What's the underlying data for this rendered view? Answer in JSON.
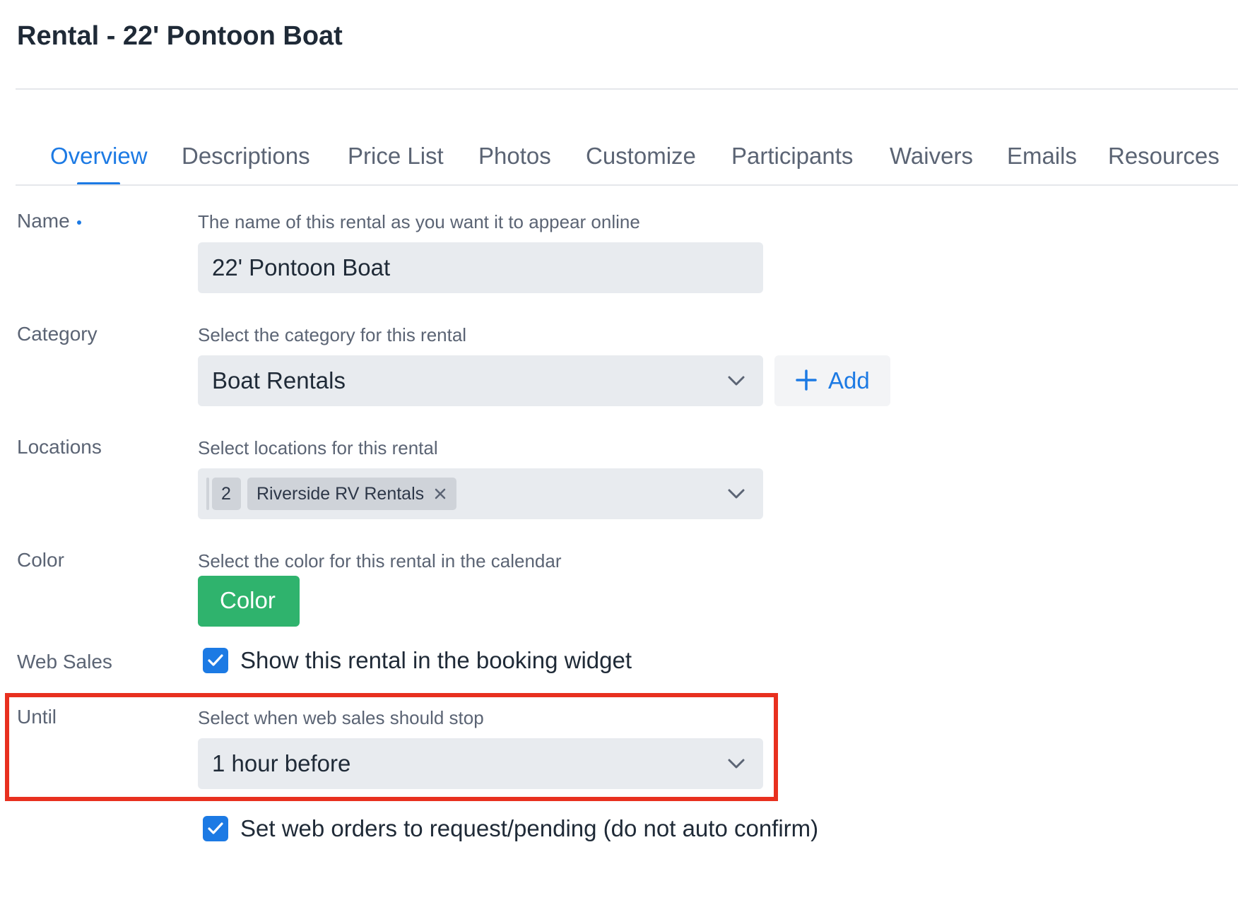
{
  "page": {
    "title": "Rental - 22' Pontoon Boat"
  },
  "tabs": [
    {
      "label": "Overview",
      "active": true
    },
    {
      "label": "Descriptions"
    },
    {
      "label": "Price List"
    },
    {
      "label": "Photos"
    },
    {
      "label": "Customize"
    },
    {
      "label": "Participants"
    },
    {
      "label": "Waivers"
    },
    {
      "label": "Emails"
    },
    {
      "label": "Resources"
    }
  ],
  "form": {
    "name": {
      "label": "Name",
      "required": true,
      "help": "The name of this rental as you want it to appear online",
      "value": "22' Pontoon Boat"
    },
    "category": {
      "label": "Category",
      "help": "Select the category for this rental",
      "value": "Boat Rentals",
      "add_label": "Add"
    },
    "locations": {
      "label": "Locations",
      "help": "Select locations for this rental",
      "count": "2",
      "selected": [
        "Riverside RV Rentals"
      ]
    },
    "color": {
      "label": "Color",
      "help": "Select the color for this rental in the calendar",
      "button_label": "Color",
      "value": "#2fb36d"
    },
    "web_sales": {
      "label": "Web Sales",
      "checkbox_label": "Show this rental in the booking widget",
      "checked": true
    },
    "until": {
      "label": "Until",
      "help": "Select when web sales should stop",
      "value": "1 hour before",
      "highlighted": true
    },
    "request_pending": {
      "checkbox_label": "Set web orders to request/pending (do not auto confirm)",
      "checked": true
    }
  },
  "colors": {
    "accent": "#1c7ae4",
    "success": "#2fb36d",
    "highlight": "#e8301f"
  },
  "icons": {
    "dropdown": "chevron-down-icon",
    "add": "plus-icon",
    "remove": "close-icon",
    "check": "check-icon"
  }
}
